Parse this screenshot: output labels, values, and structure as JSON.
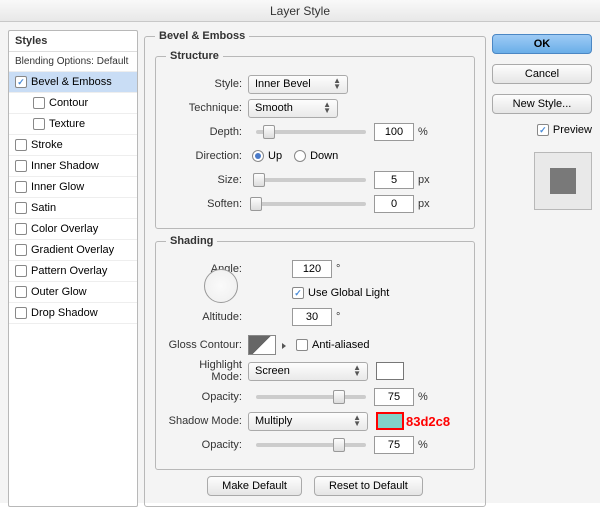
{
  "title": "Layer Style",
  "sidebar": {
    "header": "Styles",
    "subheader": "Blending Options: Default",
    "items": [
      {
        "label": "Bevel & Emboss",
        "checked": true,
        "selected": true
      },
      {
        "label": "Contour",
        "checked": false,
        "indent": true
      },
      {
        "label": "Texture",
        "checked": false,
        "indent": true
      },
      {
        "label": "Stroke",
        "checked": false
      },
      {
        "label": "Inner Shadow",
        "checked": false
      },
      {
        "label": "Inner Glow",
        "checked": false
      },
      {
        "label": "Satin",
        "checked": false
      },
      {
        "label": "Color Overlay",
        "checked": false
      },
      {
        "label": "Gradient Overlay",
        "checked": false
      },
      {
        "label": "Pattern Overlay",
        "checked": false
      },
      {
        "label": "Outer Glow",
        "checked": false
      },
      {
        "label": "Drop Shadow",
        "checked": false
      }
    ]
  },
  "panel": {
    "title": "Bevel & Emboss",
    "structure": {
      "legend": "Structure",
      "style_label": "Style:",
      "style_value": "Inner Bevel",
      "technique_label": "Technique:",
      "technique_value": "Smooth",
      "depth_label": "Depth:",
      "depth_value": "100",
      "depth_unit": "%",
      "direction_label": "Direction:",
      "dir_up": "Up",
      "dir_down": "Down",
      "size_label": "Size:",
      "size_value": "5",
      "size_unit": "px",
      "soften_label": "Soften:",
      "soften_value": "0",
      "soften_unit": "px"
    },
    "shading": {
      "legend": "Shading",
      "angle_label": "Angle:",
      "angle_value": "120",
      "angle_unit": "°",
      "use_global": "Use Global Light",
      "altitude_label": "Altitude:",
      "altitude_value": "30",
      "altitude_unit": "°",
      "gloss_label": "Gloss Contour:",
      "anti_aliased": "Anti-aliased",
      "highlight_mode_label": "Highlight Mode:",
      "highlight_mode_value": "Screen",
      "opacity_label": "Opacity:",
      "highlight_opacity_value": "75",
      "opacity_unit": "%",
      "shadow_mode_label": "Shadow Mode:",
      "shadow_mode_value": "Multiply",
      "shadow_opacity_value": "75",
      "shadow_color": "#83d2c8",
      "annotation": "83d2c8"
    },
    "make_default": "Make Default",
    "reset_default": "Reset to Default"
  },
  "buttons": {
    "ok": "OK",
    "cancel": "Cancel",
    "new_style": "New Style...",
    "preview": "Preview"
  }
}
